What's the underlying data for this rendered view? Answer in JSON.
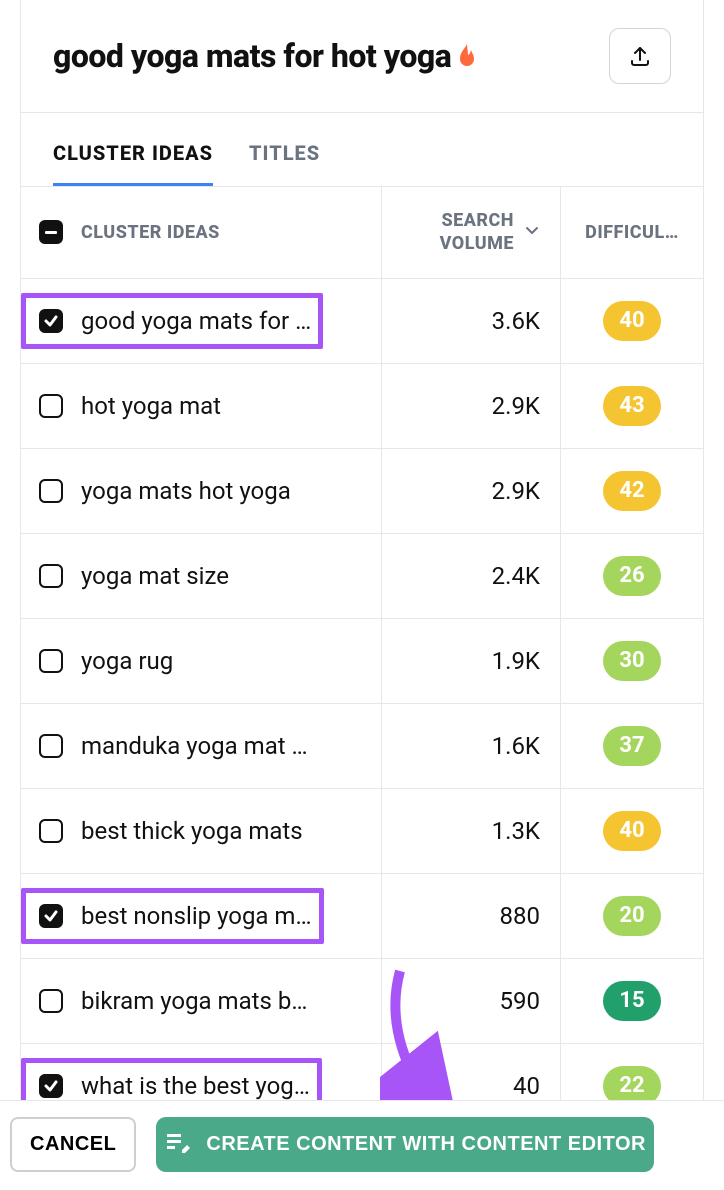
{
  "header": {
    "title": "good yoga mats for hot yoga"
  },
  "tabs": {
    "cluster_ideas": "CLUSTER IDEAS",
    "titles": "TITLES"
  },
  "columns": {
    "cluster": "CLUSTER IDEAS",
    "volume_line1": "SEARCH",
    "volume_line2": "VOLUME",
    "difficulty": "DIFFICUL…"
  },
  "rows": [
    {
      "keyword": "good yoga mats for …",
      "volume": "3.6K",
      "difficulty": "40",
      "diff_color": "yellow",
      "checked": true,
      "highlight": true
    },
    {
      "keyword": "hot yoga mat",
      "volume": "2.9K",
      "difficulty": "43",
      "diff_color": "yellow",
      "checked": false,
      "highlight": false
    },
    {
      "keyword": "yoga mats hot yoga",
      "volume": "2.9K",
      "difficulty": "42",
      "diff_color": "yellow",
      "checked": false,
      "highlight": false
    },
    {
      "keyword": "yoga mat size",
      "volume": "2.4K",
      "difficulty": "26",
      "diff_color": "lime",
      "checked": false,
      "highlight": false
    },
    {
      "keyword": "yoga rug",
      "volume": "1.9K",
      "difficulty": "30",
      "diff_color": "lime",
      "checked": false,
      "highlight": false
    },
    {
      "keyword": "manduka yoga mat …",
      "volume": "1.6K",
      "difficulty": "37",
      "diff_color": "lime",
      "checked": false,
      "highlight": false
    },
    {
      "keyword": "best thick yoga mats",
      "volume": "1.3K",
      "difficulty": "40",
      "diff_color": "yellow",
      "checked": false,
      "highlight": false
    },
    {
      "keyword": "best nonslip yoga m…",
      "volume": "880",
      "difficulty": "20",
      "diff_color": "lime",
      "checked": true,
      "highlight": true
    },
    {
      "keyword": "bikram yoga mats b…",
      "volume": "590",
      "difficulty": "15",
      "diff_color": "green",
      "checked": false,
      "highlight": false
    },
    {
      "keyword": "what is the best yog…",
      "volume": "40",
      "difficulty": "22",
      "diff_color": "lime",
      "checked": true,
      "highlight": true
    }
  ],
  "footer": {
    "cancel": "CANCEL",
    "create": "CREATE CONTENT WITH CONTENT EDITOR"
  }
}
